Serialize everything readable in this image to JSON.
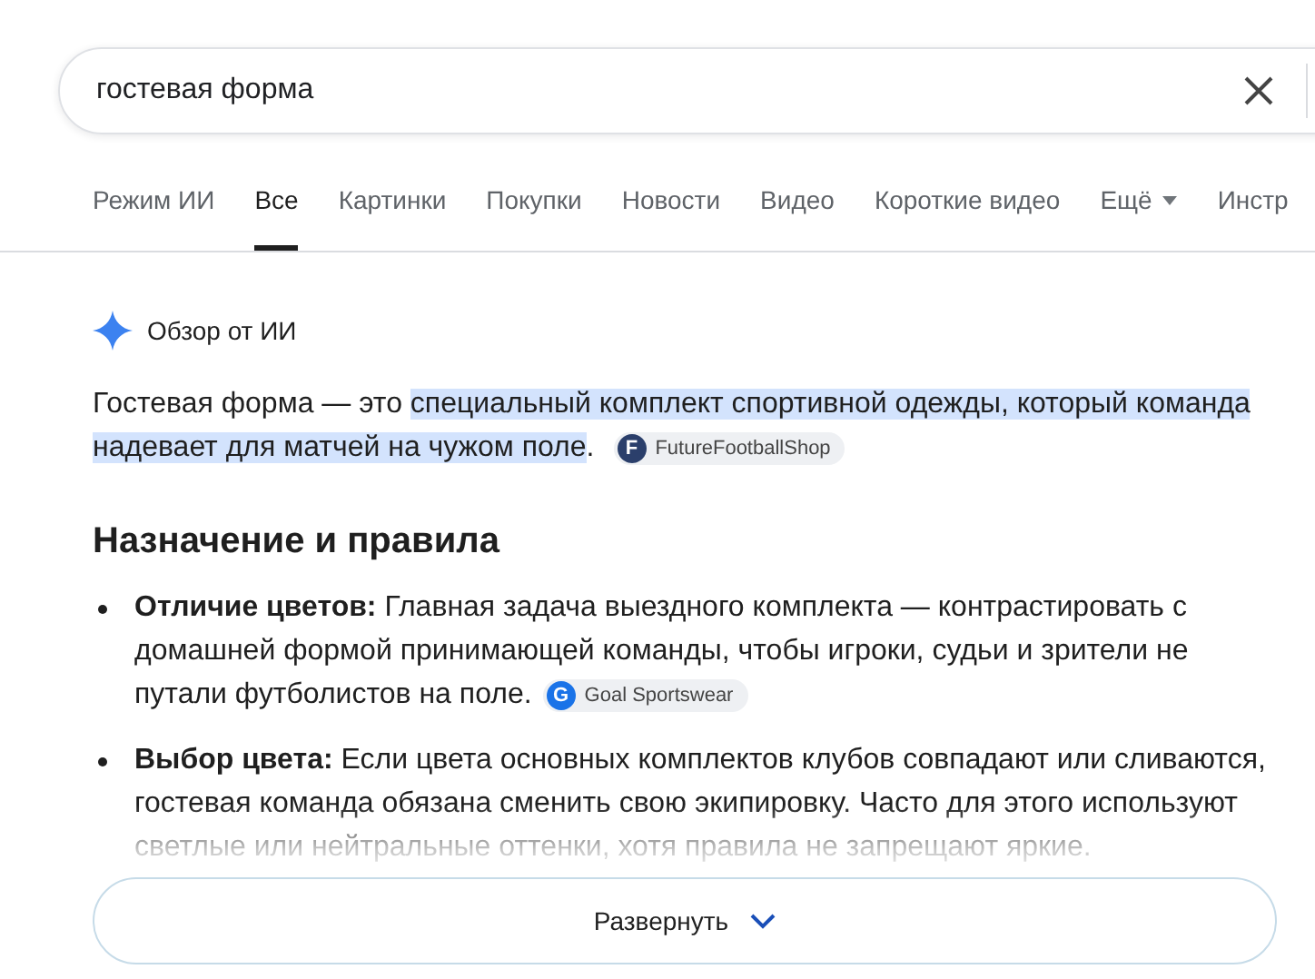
{
  "search": {
    "value": "гостевая форма"
  },
  "tabs": [
    {
      "label": "Режим ИИ",
      "selected": false,
      "kind": "plain"
    },
    {
      "label": "Все",
      "selected": true,
      "kind": "plain"
    },
    {
      "label": "Картинки",
      "selected": false,
      "kind": "plain"
    },
    {
      "label": "Покупки",
      "selected": false,
      "kind": "plain"
    },
    {
      "label": "Новости",
      "selected": false,
      "kind": "plain"
    },
    {
      "label": "Видео",
      "selected": false,
      "kind": "plain"
    },
    {
      "label": "Короткие видео",
      "selected": false,
      "kind": "plain"
    },
    {
      "label": "Ещё",
      "selected": false,
      "kind": "menu"
    },
    {
      "label": "Инстр",
      "selected": false,
      "kind": "plain"
    }
  ],
  "overview": {
    "label": "Обзор от ИИ",
    "intro": {
      "text": "Гостевая форма — это ",
      "highlight": "специальный комплект спортивной одежды, который команда надевает для матчей на чужом поле",
      "after": ".",
      "source": {
        "name": "FutureFootballShop",
        "logo": "F"
      }
    },
    "heading": "Назначение и правила",
    "bullets": [
      {
        "text": "**Отличие цветов:** Главная задача выездного комплекта — контрастировать с домашней формой принимающей команды, чтобы игроки, судьи и зрители не путали футболистов на поле.",
        "source": {
          "name": "Goal Sportswear",
          "logo": "G"
        }
      },
      {
        "text": "**Выбор цвета:** Если цвета основных комплектов клубов совпадают или сливаются, гостевая команда обязана сменить свою экипировку. Часто для этого используют светлые или нейтральные оттенки, хотя правила не запрещают яркие."
      }
    ],
    "expand": "Развернуть"
  }
}
